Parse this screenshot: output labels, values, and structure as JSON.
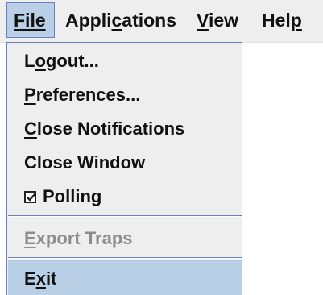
{
  "menubar": {
    "items": [
      {
        "label": "File",
        "mnemonic": "F"
      },
      {
        "label": "Applications",
        "mnemonic": "c"
      },
      {
        "label": "View",
        "mnemonic": "V"
      },
      {
        "label": "Help",
        "mnemonic": "p"
      }
    ]
  },
  "file_menu": {
    "items": [
      {
        "label": "Logout...",
        "enabled": true
      },
      {
        "label": "Preferences...",
        "enabled": true
      },
      {
        "label": "Close Notifications",
        "enabled": true
      },
      {
        "label": "Close Window",
        "enabled": true
      },
      {
        "label": "Polling",
        "enabled": true,
        "checked": true
      },
      {
        "label": "Export Traps",
        "enabled": false
      },
      {
        "label": "Exit",
        "enabled": true,
        "highlighted": true
      }
    ]
  },
  "colors": {
    "menu_background": "#eeeeee",
    "highlight": "#b8cfe5",
    "border": "#6382bf",
    "disabled_text": "#8d8d8d"
  }
}
